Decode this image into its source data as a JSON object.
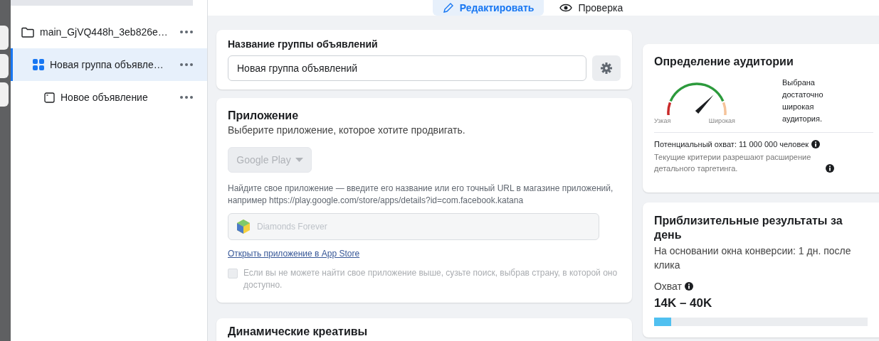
{
  "sidebar": {
    "tree": [
      {
        "kind": "campaign",
        "label": "main_GjVQ448h_3eb826e…",
        "selected": false,
        "children": [
          {
            "kind": "adset",
            "label": "Новая группа объявле…",
            "selected": true,
            "children": [
              {
                "kind": "ad",
                "label": "Новое объявление",
                "selected": false
              }
            ]
          }
        ]
      }
    ]
  },
  "tabs": [
    {
      "kind": "edit",
      "label": "Редактировать",
      "selected": true
    },
    {
      "kind": "review",
      "label": "Проверка",
      "selected": false
    }
  ],
  "name_card": {
    "title": "Название группы объявлений",
    "value": "Новая группа объявлений"
  },
  "app_card": {
    "title": "Приложение",
    "subtitle": "Выберите приложение, которое хотите продвигать.",
    "store": {
      "label": "Google Play",
      "disabled": true
    },
    "hint": "Найдите свое приложение — введите его название или его точный URL в магазине приложений, например https://play.google.com/store/apps/details?id=com.facebook.katana",
    "app_field": {
      "value": "Diamonds Forever",
      "disabled": true
    },
    "link": "Открыть приложение в App Store",
    "checkbox": {
      "label": "Если вы не можете найти свое приложение выше, сузьте поиск, выбрав страну, в которой оно доступно.",
      "checked": false,
      "disabled": true
    }
  },
  "dynamic_card": {
    "title": "Динамические креативы"
  },
  "audience_card": {
    "title": "Определение аудитории",
    "gauge": {
      "level": 0.7,
      "min_label": "Узкая",
      "max_label": "Широкая"
    },
    "verdict": "Выбрана достаточно широкая аудитория.",
    "reach": "Потенциальный охват: 11 000 000 человек",
    "note": "Текущие критерии разрешают расширение детального таргетинга."
  },
  "results_card": {
    "title": "Приблизительные результаты за день",
    "subtitle": "На основании окна конверсии: 1 дн. после клика",
    "metric": "Охват",
    "range": "14K – 40K",
    "bar": {
      "level": 0.08
    }
  }
}
